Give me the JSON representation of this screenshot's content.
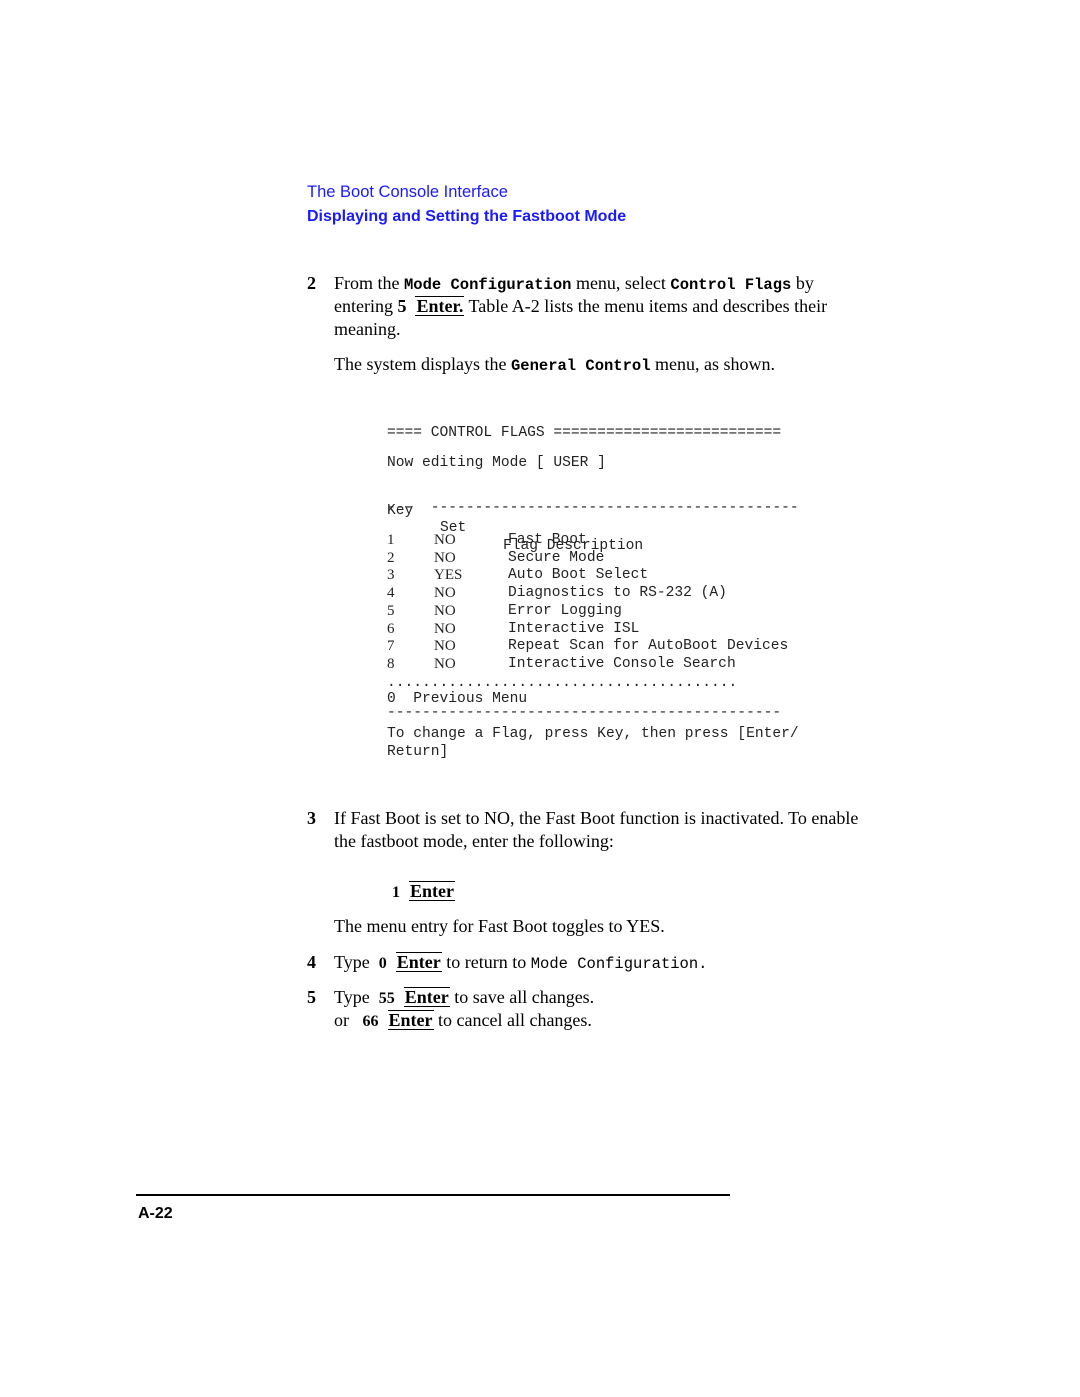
{
  "header": {
    "section": "The Boot Console Interface",
    "subsection": "Displaying and Setting the Fastboot Mode"
  },
  "step2": {
    "num": "2",
    "t1": "From the ",
    "c1": "Mode Configuration",
    "t2": " menu, select ",
    "c2": "Control Flags",
    "t3": " by",
    "t4": "entering ",
    "n1": "5",
    "key": "Enter.",
    "t5": " Table A-2 lists the menu items and describes their",
    "t6": "meaning.",
    "p1": "The system displays the ",
    "pc": "General Control",
    "p2": " menu, as shown."
  },
  "console": {
    "title": "==== CONTROL FLAGS ==========================",
    "mode_line": "Now editing Mode [ USER ]",
    "col_key": "Key",
    "col_set": "Set",
    "col_desc": "Flag Description",
    "sep1": "---  ------------------------------------------",
    "rows": [
      {
        "key": "1",
        "set": "NO",
        "desc": "Fast Boot"
      },
      {
        "key": "2",
        "set": "NO",
        "desc": "Secure Mode"
      },
      {
        "key": "3",
        "set": "YES",
        "desc": "Auto Boot Select"
      },
      {
        "key": "4",
        "set": "NO",
        "desc": "Diagnostics to RS-232 (A)"
      },
      {
        "key": "5",
        "set": "NO",
        "desc": "Error Logging"
      },
      {
        "key": "6",
        "set": "NO",
        "desc": "Interactive ISL"
      },
      {
        "key": "7",
        "set": "NO",
        "desc": "Repeat Scan for AutoBoot Devices"
      },
      {
        "key": "8",
        "set": "NO",
        "desc": "Interactive Console Search"
      }
    ],
    "dots": "........................................",
    "previous": "0  Previous Menu",
    "sep2": "---------------------------------------------",
    "hint1": "To change a Flag, press Key, then press [Enter/",
    "hint2": "Return]"
  },
  "step3": {
    "num": "3",
    "l1": "If Fast Boot is set to NO, the Fast Boot function is inactivated. To enable",
    "l2": "the fastboot mode, enter the following:",
    "entry_num": "1",
    "entry_key": "Enter",
    "result": "The menu entry for Fast Boot toggles to YES."
  },
  "step4": {
    "num": "4",
    "t1": "Type ",
    "n": "0",
    "key": "Enter",
    "t2": " to return to ",
    "code": "Mode Configuration."
  },
  "step5": {
    "num": "5",
    "t1": "Type ",
    "n": "55",
    "key": "Enter",
    "t2": " to save all changes.",
    "or": "or ",
    "n2": "66",
    "key2": "Enter",
    "t3": " to cancel all changes."
  },
  "footer": {
    "page_number": "A-22"
  }
}
